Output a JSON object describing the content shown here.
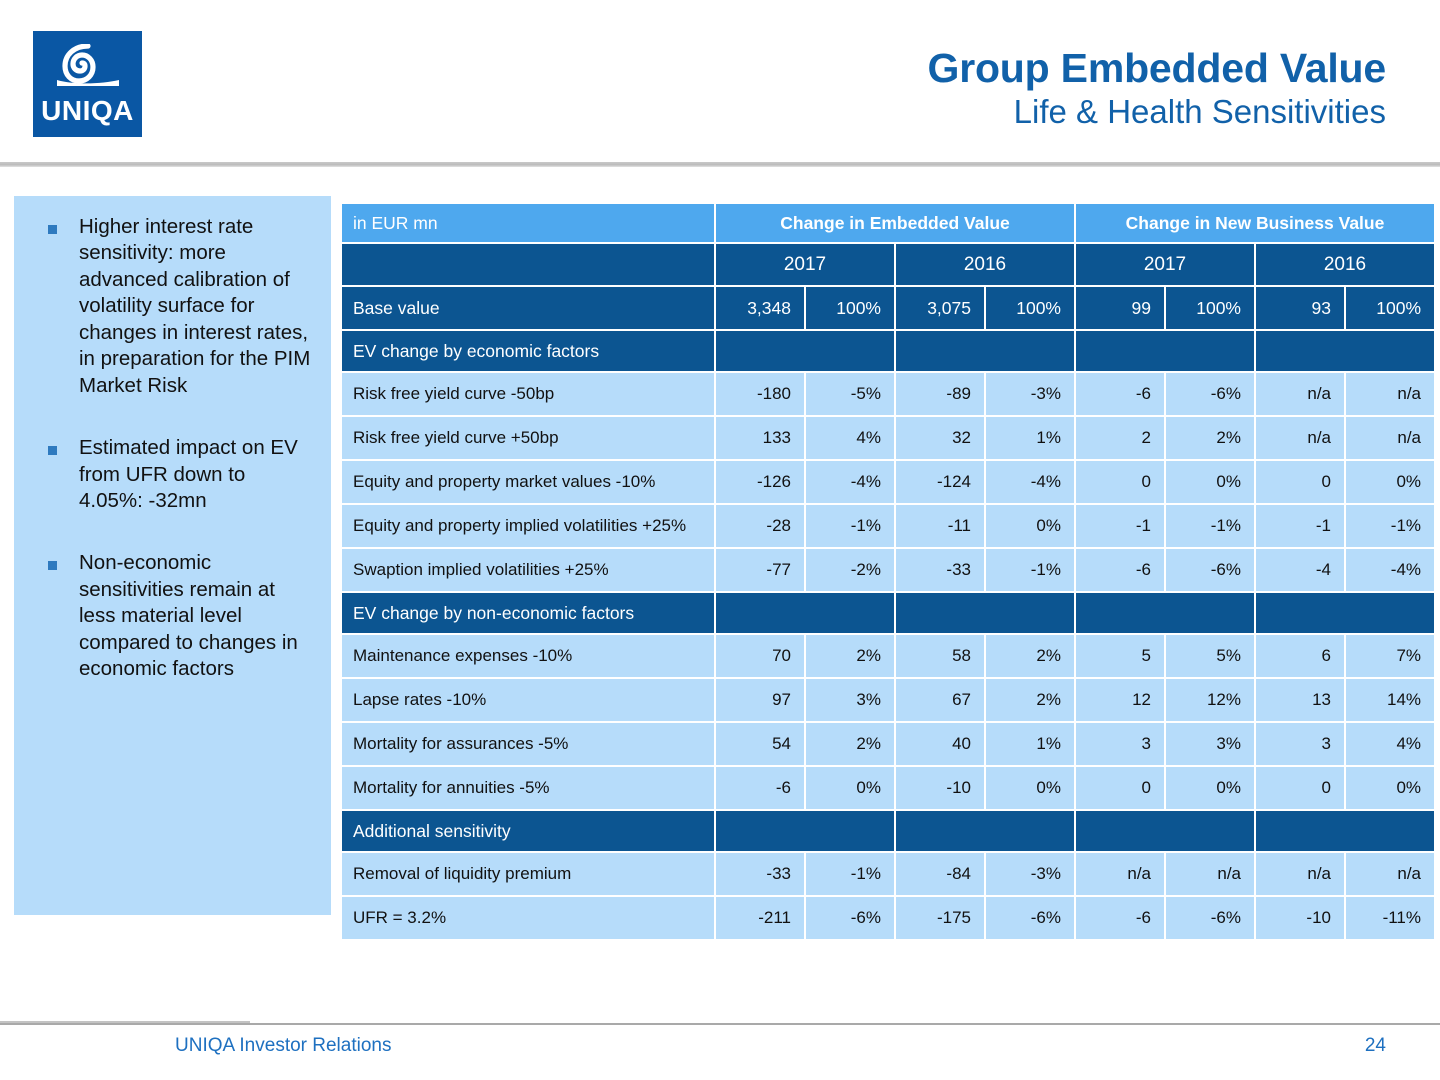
{
  "brand": {
    "logo_word": "UNIQA",
    "logo_bg": "#0A57A4",
    "accent_blue": "#1161A9"
  },
  "header": {
    "title": "Group Embedded Value",
    "subtitle": "Life & Health Sensitivities"
  },
  "notes": {
    "items": [
      "Higher interest rate sensitivity: more advanced calibration of volatility surface for changes in interest rates, in preparation for the PIM Market Risk",
      "Estimated impact on EV from UFR down to 4.05%:  -32mn",
      "Non-economic sensitivities remain at less material level compared to changes in economic factors"
    ]
  },
  "table": {
    "unit_label": "in EUR mn",
    "group_headers": [
      "Change in Embedded Value",
      "Change in New Business Value"
    ],
    "year_headers": [
      "2017",
      "2016",
      "2017",
      "2016"
    ],
    "base_row": {
      "label": "Base value",
      "values": [
        "3,348",
        "100%",
        "3,075",
        "100%",
        "99",
        "100%",
        "93",
        "100%"
      ]
    },
    "sections": [
      {
        "title": "EV change by economic factors",
        "rows": [
          {
            "label": "Risk free yield curve -50bp",
            "values": [
              "-180",
              "-5%",
              "-89",
              "-3%",
              "-6",
              "-6%",
              "n/a",
              "n/a"
            ]
          },
          {
            "label": "Risk free yield curve +50bp",
            "values": [
              "133",
              "4%",
              "32",
              "1%",
              "2",
              "2%",
              "n/a",
              "n/a"
            ]
          },
          {
            "label": "Equity and property market values -10%",
            "values": [
              "-126",
              "-4%",
              "-124",
              "-4%",
              "0",
              "0%",
              "0",
              "0%"
            ]
          },
          {
            "label": "Equity and property implied volatilities +25%",
            "values": [
              "-28",
              "-1%",
              "-11",
              "0%",
              "-1",
              "-1%",
              "-1",
              "-1%"
            ]
          },
          {
            "label": "Swaption implied volatilities +25%",
            "values": [
              "-77",
              "-2%",
              "-33",
              "-1%",
              "-6",
              "-6%",
              "-4",
              "-4%"
            ]
          }
        ]
      },
      {
        "title": "EV change by non-economic factors",
        "rows": [
          {
            "label": "Maintenance expenses -10%",
            "values": [
              "70",
              "2%",
              "58",
              "2%",
              "5",
              "5%",
              "6",
              "7%"
            ]
          },
          {
            "label": "Lapse rates -10%",
            "values": [
              "97",
              "3%",
              "67",
              "2%",
              "12",
              "12%",
              "13",
              "14%"
            ]
          },
          {
            "label": "Mortality for assurances -5%",
            "values": [
              "54",
              "2%",
              "40",
              "1%",
              "3",
              "3%",
              "3",
              "4%"
            ]
          },
          {
            "label": "Mortality for annuities -5%",
            "values": [
              "-6",
              "0%",
              "-10",
              "0%",
              "0",
              "0%",
              "0",
              "0%"
            ]
          }
        ]
      },
      {
        "title": "Additional sensitivity",
        "rows": [
          {
            "label": "Removal of liquidity premium",
            "values": [
              "-33",
              "-1%",
              "-84",
              "-3%",
              "n/a",
              "n/a",
              "n/a",
              "n/a"
            ]
          },
          {
            "label": "UFR = 3.2%",
            "values": [
              "-211",
              "-6%",
              "-175",
              "-6%",
              "-6",
              "-6%",
              "-10",
              "-11%"
            ]
          }
        ]
      }
    ]
  },
  "footer": {
    "left_text": "UNIQA Investor Relations",
    "page_number": "24"
  }
}
